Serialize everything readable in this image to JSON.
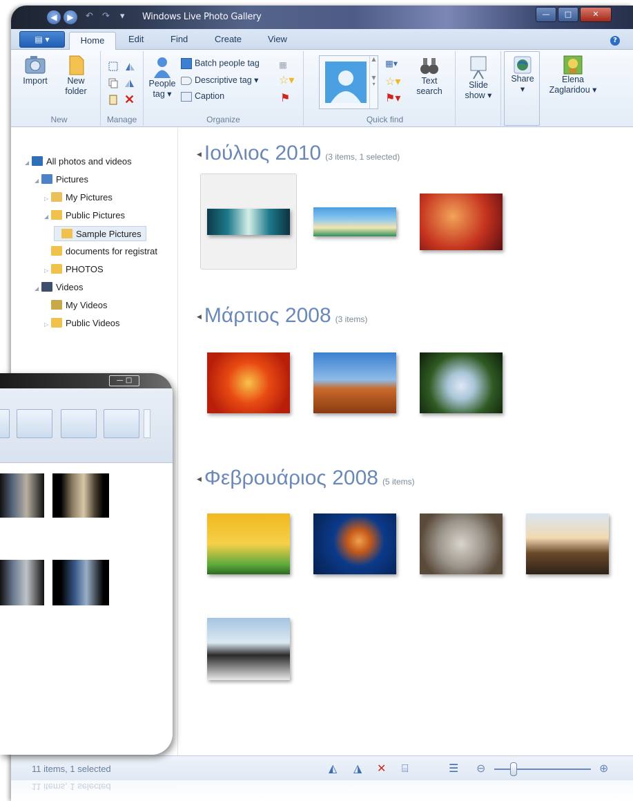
{
  "window": {
    "title": "Windows Live Photo Gallery",
    "help": "?"
  },
  "tabs": [
    "Home",
    "Edit",
    "Find",
    "Create",
    "View"
  ],
  "ribbon": {
    "new": {
      "import": "Import",
      "new_folder_1": "New",
      "new_folder_2": "folder",
      "label": "New"
    },
    "manage": {
      "label": "Manage"
    },
    "organize": {
      "people_tag_1": "People",
      "people_tag_2": "tag ▾",
      "batch": "Batch people tag",
      "descriptive": "Descriptive tag ▾",
      "caption": "Caption",
      "label": "Organize"
    },
    "quick_find": {
      "text_search_1": "Text",
      "text_search_2": "search",
      "label": "Quick find"
    },
    "slide_show_1": "Slide",
    "slide_show_2": "show ▾",
    "share": "Share",
    "share_arrow": "▾",
    "user_1": "Elena",
    "user_2": "Zaglaridou ▾"
  },
  "sidebar": {
    "items": [
      {
        "label": "All photos and videos"
      },
      {
        "label": "Pictures"
      },
      {
        "label": "My Pictures"
      },
      {
        "label": "Public Pictures"
      },
      {
        "label": "Sample Pictures"
      },
      {
        "label": "documents for registrat"
      },
      {
        "label": "PHOTOS"
      },
      {
        "label": "Videos"
      },
      {
        "label": "My Videos"
      },
      {
        "label": "Public Videos"
      }
    ]
  },
  "groups": [
    {
      "title": "Ιούλιος 2010",
      "count": "(3 items, 1 selected)"
    },
    {
      "title": "Μάρτιος 2008",
      "count": "(3 items)"
    },
    {
      "title": "Φεβρουάριος 2008",
      "count": "(5 items)"
    }
  ],
  "status": {
    "text": "11 items, 1 selected",
    "zoom_fraction": 0.2
  },
  "colors": {
    "accent": "#6a88b8",
    "tab_text": "#1e395b"
  }
}
